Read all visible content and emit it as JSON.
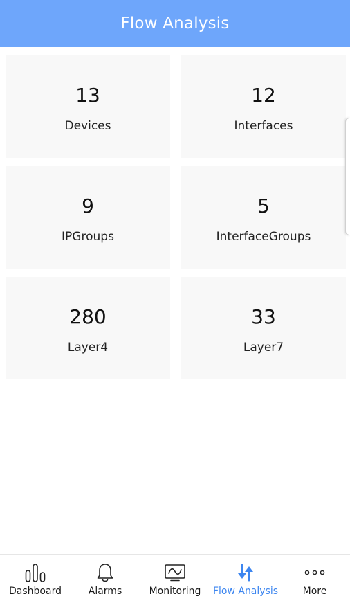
{
  "header": {
    "title": "Flow Analysis"
  },
  "stats": [
    {
      "value": "13",
      "label": "Devices"
    },
    {
      "value": "12",
      "label": "Interfaces"
    },
    {
      "value": "9",
      "label": "IPGroups"
    },
    {
      "value": "5",
      "label": "InterfaceGroups"
    },
    {
      "value": "280",
      "label": "Layer4"
    },
    {
      "value": "33",
      "label": "Layer7"
    }
  ],
  "nav": {
    "active": "Flow Analysis",
    "items": [
      {
        "label": "Dashboard",
        "icon": "bar-chart-icon"
      },
      {
        "label": "Alarms",
        "icon": "bell-icon"
      },
      {
        "label": "Monitoring",
        "icon": "monitor-icon"
      },
      {
        "label": "Flow Analysis",
        "icon": "up-down-arrows-icon"
      },
      {
        "label": "More",
        "icon": "more-dots-icon"
      }
    ]
  },
  "colors": {
    "header_bg": "#6ea6fb",
    "active_accent": "#3d86f0",
    "card_bg": "#f8f8f8"
  }
}
